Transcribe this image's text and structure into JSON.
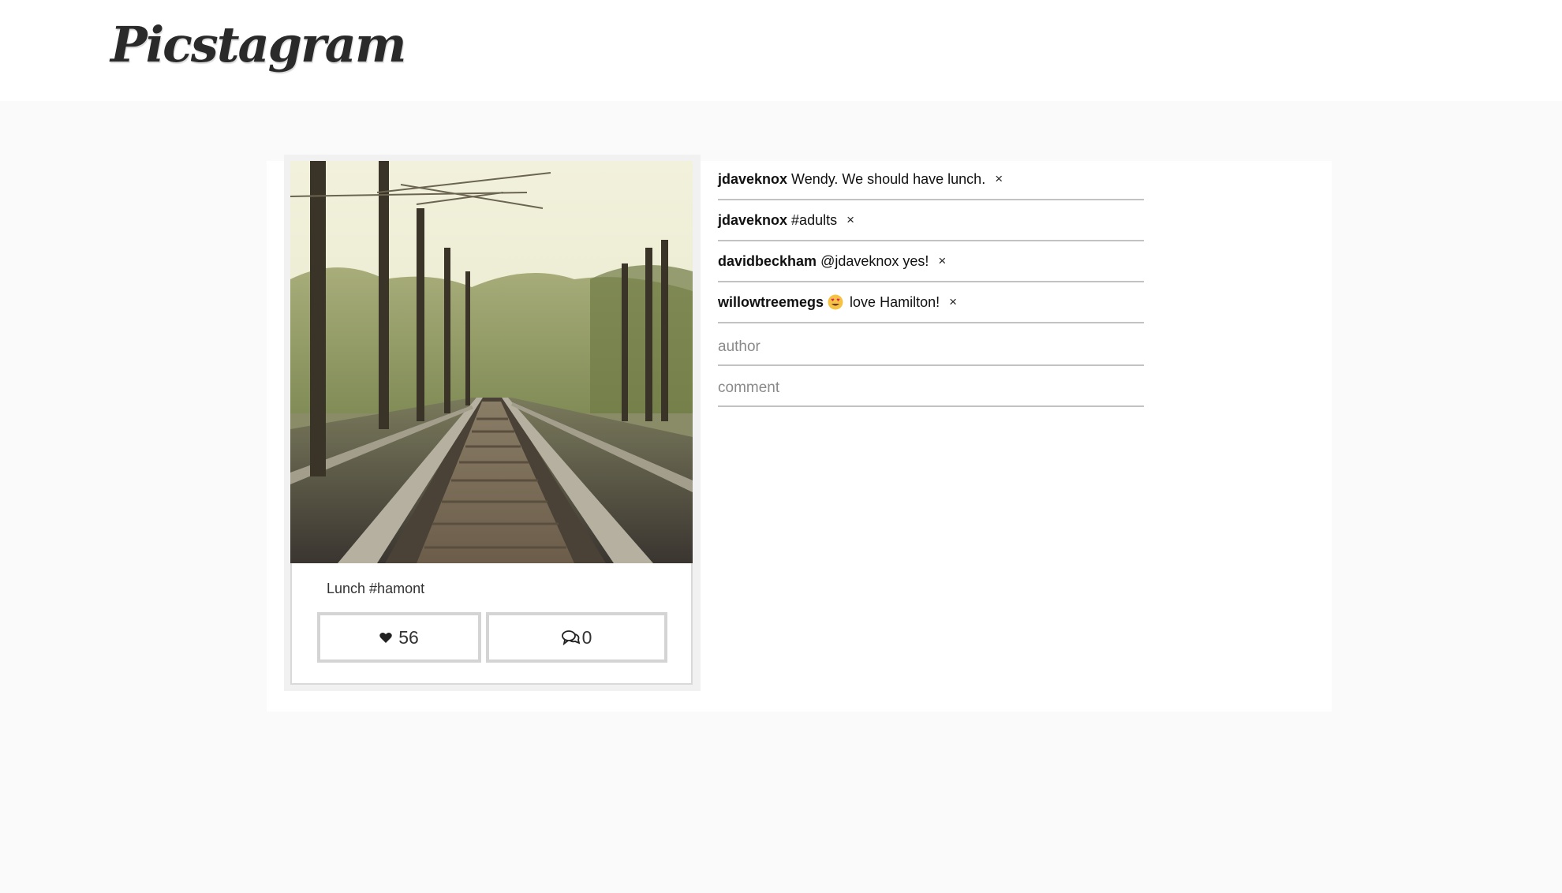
{
  "header": {
    "logo": "Picstagram"
  },
  "post": {
    "caption": "Lunch #hamont",
    "likes": "56",
    "comment_count": "0",
    "like_icon": "heart-icon",
    "comment_icon": "speech-bubbles-icon",
    "photo_description": "railway-tracks-photo"
  },
  "comments": [
    {
      "author": "jdaveknox",
      "text": "Wendy. We should have lunch.",
      "remove": "×"
    },
    {
      "author": "jdaveknox",
      "text": "#adults",
      "remove": "×"
    },
    {
      "author": "davidbeckham",
      "text": "@jdaveknox yes!",
      "remove": "×"
    },
    {
      "author": "willowtreemegs",
      "text": "love Hamilton!",
      "emoji": "heart-eyes-emoji",
      "remove": "×"
    }
  ],
  "form": {
    "author_placeholder": "author",
    "comment_placeholder": "comment"
  },
  "colors": {
    "page_background": "#fafafa",
    "border": "#d4d4d4",
    "text": "#111111"
  }
}
